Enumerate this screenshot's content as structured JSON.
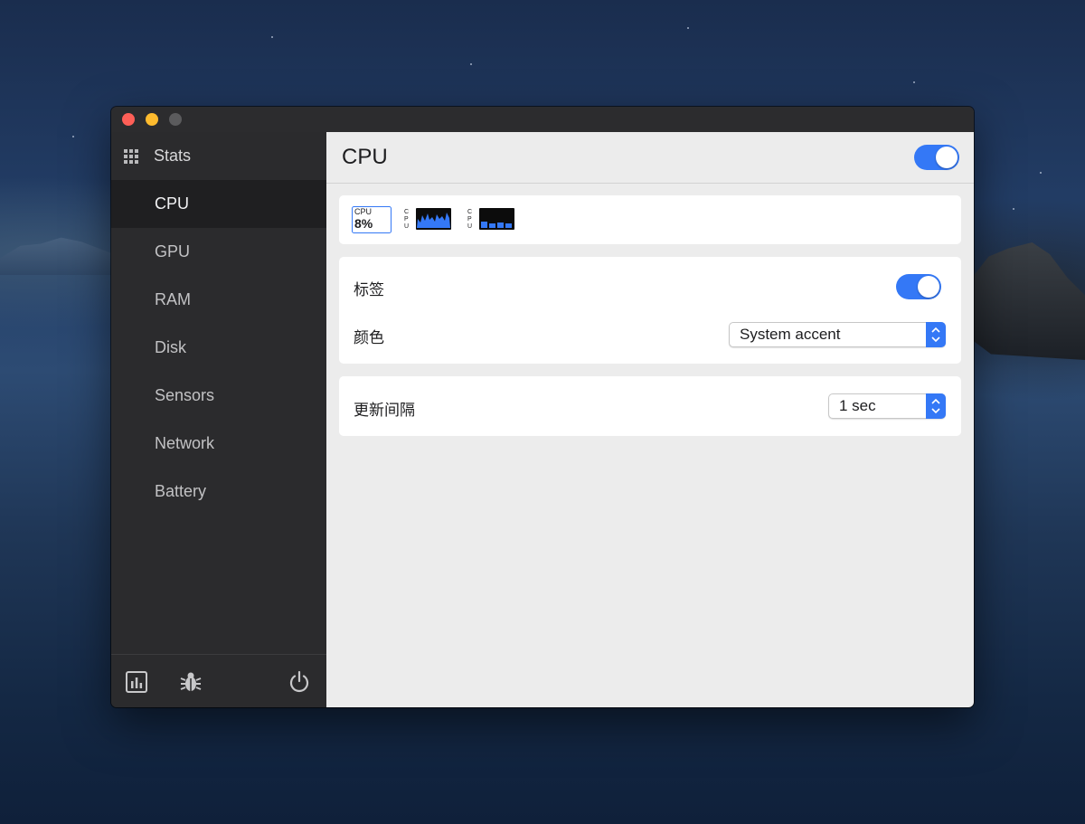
{
  "window": {
    "sidebar": {
      "title": "Stats",
      "items": [
        {
          "label": "CPU",
          "active": true
        },
        {
          "label": "GPU",
          "active": false
        },
        {
          "label": "RAM",
          "active": false
        },
        {
          "label": "Disk",
          "active": false
        },
        {
          "label": "Sensors",
          "active": false
        },
        {
          "label": "Network",
          "active": false
        },
        {
          "label": "Battery",
          "active": false
        }
      ],
      "footer_icons": [
        "bar-chart-icon",
        "bug-icon",
        "power-icon"
      ]
    },
    "main": {
      "title": "CPU",
      "enabled": true,
      "widgets": [
        {
          "kind": "mini",
          "label": "CPU",
          "value": "8%"
        },
        {
          "kind": "line-chart",
          "label": "CPU"
        },
        {
          "kind": "bar-chart",
          "label": "CPU"
        }
      ],
      "settings": {
        "label_row": {
          "label": "标签",
          "enabled": true
        },
        "color_row": {
          "label": "颜色",
          "value": "System accent"
        },
        "interval_row": {
          "label": "更新间隔",
          "value": "1 sec"
        }
      }
    }
  },
  "colors": {
    "accent": "#3478f6",
    "sidebar_bg": "#2b2b2d",
    "main_bg": "#ececec"
  }
}
